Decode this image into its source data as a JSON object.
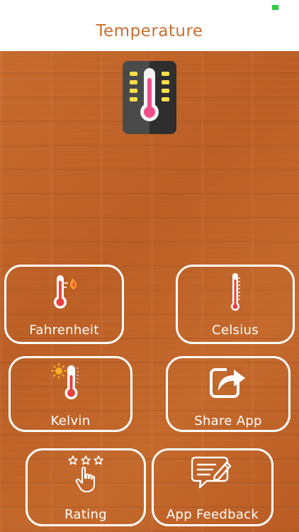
{
  "header": {
    "title": "Temperature",
    "title_color": "#c8702f"
  },
  "colors": {
    "background": "#c2642a",
    "tile_border": "#ffffff",
    "text": "#ffffff"
  },
  "app_icon": "thermometer-app-icon",
  "tiles": [
    {
      "label": "Fahrenheit",
      "icon": "thermometer-flame-icon"
    },
    {
      "label": "Celsius",
      "icon": "thermometer-icon"
    },
    {
      "label": "Kelvin",
      "icon": "thermometer-sun-icon"
    },
    {
      "label": "Share App",
      "icon": "share-icon"
    },
    {
      "label": "Rating",
      "icon": "rating-stars-hand-icon"
    },
    {
      "label": "App Feedback",
      "icon": "feedback-icon"
    }
  ]
}
